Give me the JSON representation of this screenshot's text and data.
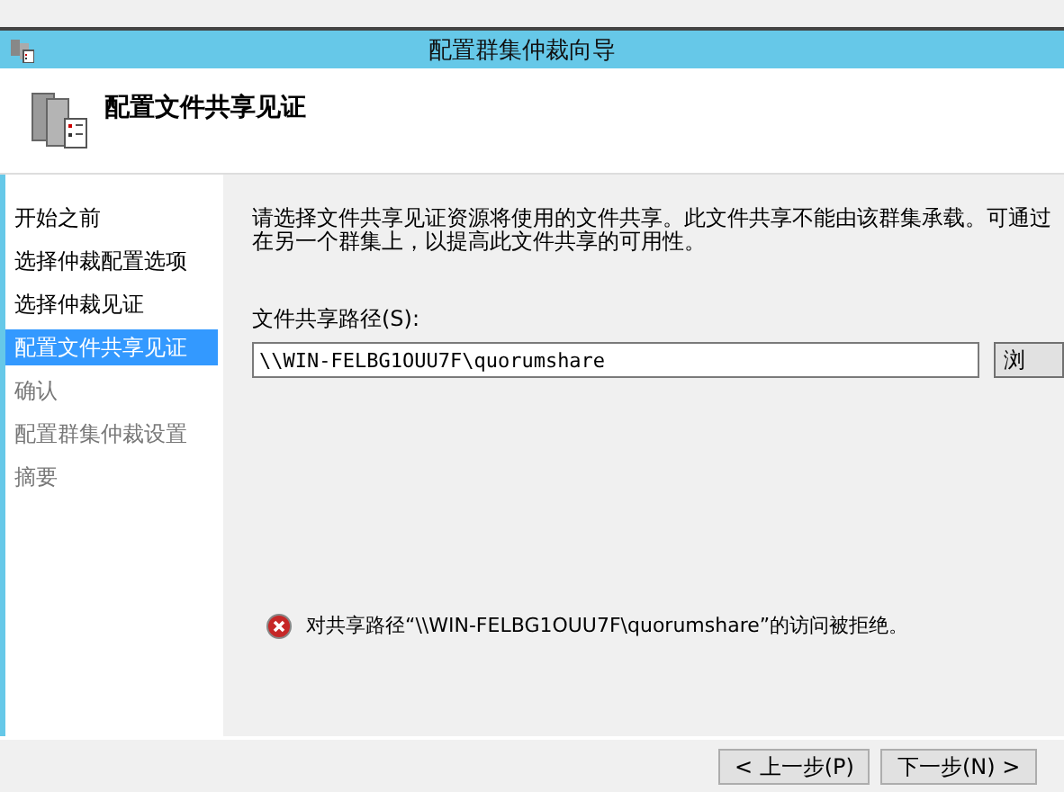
{
  "window": {
    "title": "配置群集仲裁向导"
  },
  "header": {
    "title": "配置文件共享见证"
  },
  "sidebar": {
    "items": [
      {
        "label": "开始之前",
        "selected": false,
        "disabled": false
      },
      {
        "label": "选择仲裁配置选项",
        "selected": false,
        "disabled": false
      },
      {
        "label": "选择仲裁见证",
        "selected": false,
        "disabled": false
      },
      {
        "label": "配置文件共享见证",
        "selected": true,
        "disabled": false
      },
      {
        "label": "确认",
        "selected": false,
        "disabled": true
      },
      {
        "label": "配置群集仲裁设置",
        "selected": false,
        "disabled": true
      },
      {
        "label": "摘要",
        "selected": false,
        "disabled": true
      }
    ]
  },
  "content": {
    "description_lines": [
      "请选择文件共享见证资源将使用的文件共享。此文件共享不能由该群集承载。可通过",
      "在另一个群集上，以提高此文件共享的可用性。"
    ],
    "path_label": "文件共享路径(S):",
    "path_value": "\\\\WIN-FELBG1OUU7F\\quorumshare",
    "browse_button": "浏",
    "error_message": "对共享路径“\\\\WIN-FELBG1OUU7F\\quorumshare”的访问被拒绝。"
  },
  "footer": {
    "buttons": [
      "< 上一步(P)",
      "下一步(N) >"
    ]
  }
}
